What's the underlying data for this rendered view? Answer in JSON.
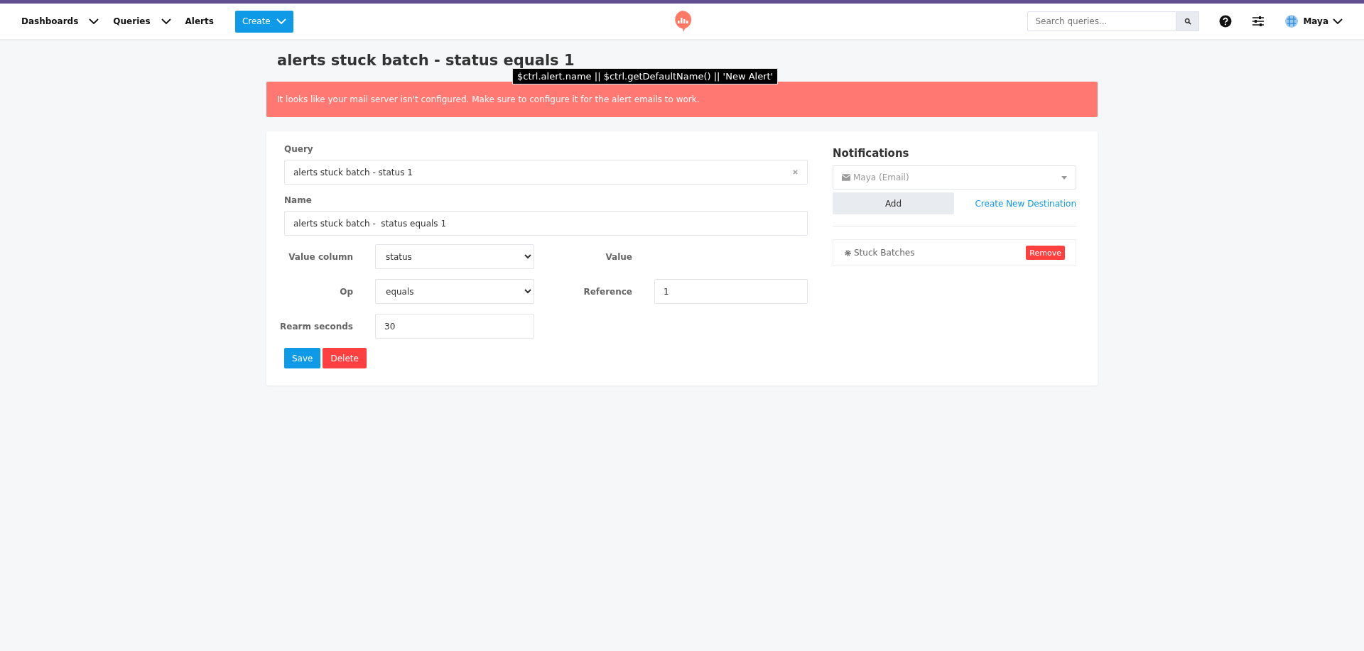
{
  "nav": {
    "items": [
      {
        "label": "Dashboards",
        "dropdown": true
      },
      {
        "label": "Queries",
        "dropdown": true
      },
      {
        "label": "Alerts",
        "dropdown": false
      }
    ],
    "create_button": "Create",
    "search": {
      "placeholder": "Search queries..."
    },
    "user": "Maya"
  },
  "page_title": "alerts stuck batch - status equals 1",
  "tooltip": "$ctrl.alert.name || $ctrl.getDefaultName() || 'New Alert'",
  "warning": "It looks like your mail server isn't configured. Make sure to configure it for the alert emails to work.",
  "form": {
    "query_label": "Query",
    "query_value": "alerts stuck batch - status 1",
    "name_label": "Name",
    "name_value": "alerts stuck batch -  status equals 1",
    "fields": [
      {
        "label": "Value column",
        "kind": "select",
        "value": "status"
      },
      {
        "label": "Value",
        "kind": "none"
      },
      {
        "label": "Op",
        "kind": "select",
        "value": "equals"
      },
      {
        "label": "Reference",
        "kind": "input",
        "value": "1"
      },
      {
        "label": "Rearm seconds",
        "kind": "input",
        "value": "30"
      }
    ],
    "save": "Save",
    "delete": "Delete"
  },
  "notifications": {
    "title": "Notifications",
    "destination_placeholder": "Maya (Email)",
    "add": "Add",
    "create_link": "Create New Destination",
    "subscriptions": [
      {
        "name": "Stuck Batches",
        "remove": "Remove"
      }
    ]
  }
}
